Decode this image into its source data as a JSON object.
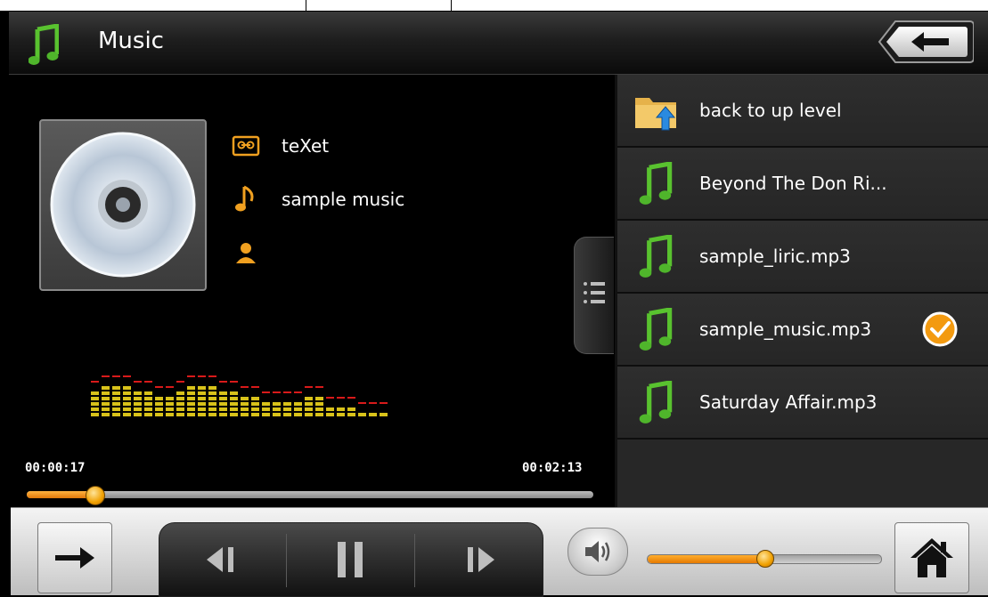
{
  "app": {
    "title": "Music"
  },
  "track": {
    "artist": "teXet",
    "title": "sample music",
    "album": ""
  },
  "playback": {
    "elapsed": "00:00:17",
    "total": "00:02:13",
    "progress": 0.12,
    "volume": 0.5
  },
  "playlist": {
    "items": [
      {
        "label": "back to up level",
        "icon": "folder-up-icon"
      },
      {
        "label": "Beyond The Don Ri...",
        "icon": "music-note-icon"
      },
      {
        "label": "sample_liric.mp3",
        "icon": "music-note-icon"
      },
      {
        "label": "sample_music.mp3",
        "icon": "music-note-icon",
        "current": true
      },
      {
        "label": "Saturday Affair.mp3",
        "icon": "music-note-icon"
      }
    ]
  },
  "equalizer": {
    "levels": [
      5,
      6,
      6,
      6,
      5,
      5,
      4,
      4,
      5,
      6,
      6,
      6,
      5,
      5,
      4,
      4,
      3,
      3,
      3,
      3,
      4,
      4,
      2,
      2,
      2,
      1,
      1,
      1
    ]
  },
  "colors": {
    "accent_orange": "#f39a10",
    "note_green": "#4fb52b",
    "eq_red": "#d81a1a",
    "eq_yellow": "#d8c21a"
  }
}
